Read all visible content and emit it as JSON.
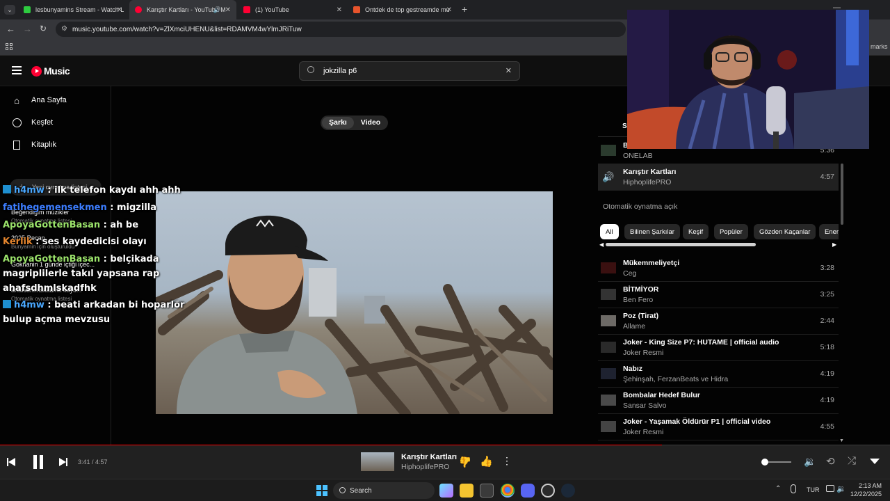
{
  "browser": {
    "tabs": [
      {
        "title": "lesbunyamins Stream - Watch L",
        "fav_color": "#2ecc40"
      },
      {
        "title": "Karıştır Kartları - YouTube M",
        "fav_color": "#ff0033"
      },
      {
        "title": "(1) YouTube",
        "fav_color": "#ff0033"
      },
      {
        "title": "Ontdek de top gestreamde mu",
        "fav_color": "#e8542c"
      }
    ],
    "url": "music.youtube.com/watch?v=ZlXmciUHENU&list=RDAMVM4wYlmJRiTuw",
    "bookmarks_label": "marks"
  },
  "header": {
    "logo_text": "Music",
    "search_value": "jokzilla p6"
  },
  "sidebar": {
    "items": [
      {
        "label": "Ana Sayfa",
        "icon": "home-icon"
      },
      {
        "label": "Keşfet",
        "icon": "explore-icon"
      },
      {
        "label": "Kitaplık",
        "icon": "library-icon"
      }
    ],
    "new_playlist": "Yeni oynatma listesi",
    "playlists": [
      {
        "title": "Beğendiğim müzikler",
        "sub": "Otomatik oynatma listesi"
      },
      {
        "title": "2025 Recap",
        "sub": "Bunyamin için oluşturuldu"
      },
      {
        "title": "Gokhanin 1 günde içtiği içec...",
        "sub": ""
      },
      {
        "title": "ahafsdhmlskadfhk kayd...",
        "sub": "Otomatik oynatma listesi"
      }
    ]
  },
  "chat": [
    {
      "user": "h4mw",
      "color": "#4aa8ff",
      "badge": true,
      "msg": " : ilk telefon kaydı ahh ahh"
    },
    {
      "user": "fatihegemensekmen",
      "color": "#3c7dff",
      "badge": false,
      "msg": " : migzilla"
    },
    {
      "user": "ApoyaGottenBasan",
      "color": "#9be36b",
      "badge": false,
      "msg": " : ah be"
    },
    {
      "user": "Kerlik",
      "color": "#e5862e",
      "badge": false,
      "msg": " : ses kaydedicisi olayı"
    },
    {
      "user": "ApoyaGottenBasan",
      "color": "#9be36b",
      "badge": false,
      "msg": " : belçikada"
    },
    {
      "user": "",
      "color": "#fff",
      "badge": false,
      "msg": "magriplilerle takıl yapsana rap"
    },
    {
      "user": "",
      "color": "#fff",
      "badge": false,
      "msg": "ahafsdhmlskadfhk"
    },
    {
      "user": "h4mw",
      "color": "#4aa8ff",
      "badge": true,
      "msg": " : beati arkadan bi hoparlör"
    },
    {
      "user": "",
      "color": "#fff",
      "badge": false,
      "msg": "bulup açma mevzusu"
    }
  ],
  "toggle": {
    "song": "Şarkı",
    "video": "Video"
  },
  "queue": {
    "tab_partial": "S",
    "prev_item": {
      "title": "B",
      "artist": "ONELAB",
      "duration": "5:36"
    },
    "current": {
      "title": "Karıştır Kartları",
      "artist": "HiphoplifePRO",
      "duration": "4:57"
    },
    "autoplay_label": "Otomatik oynatma açık",
    "chips": [
      "All",
      "Bilinen Şarkılar",
      "Keşif",
      "Popüler",
      "Gözden Kaçanlar",
      "Enerj"
    ],
    "items": [
      {
        "title": "Mükemmeliyetçi",
        "artist": "Ceg",
        "duration": "3:28"
      },
      {
        "title": "BİTMİYOR",
        "artist": "Ben Fero",
        "duration": "3:25"
      },
      {
        "title": "Poz (Tirat)",
        "artist": "Allame",
        "duration": "2:44"
      },
      {
        "title": "Joker - King Size P7: HUTAME | official audio",
        "artist": "Joker Resmi",
        "duration": "5:18"
      },
      {
        "title": "Nabız",
        "artist": "Şehinşah, FerzanBeats ve Hidra",
        "duration": "4:19"
      },
      {
        "title": "Bombalar Hedef Bulur",
        "artist": "Sansar Salvo",
        "duration": "4:19"
      },
      {
        "title": "Joker - Yaşamak Öldürür P1 | official video",
        "artist": "Joker Resmi",
        "duration": "4:55"
      }
    ]
  },
  "player": {
    "time": "3:41 / 4:57",
    "progress": 0.744,
    "title": "Karıştır Kartları",
    "artist": "HiphoplifePRO",
    "volume": 0.05
  },
  "taskbar": {
    "search_label": "Search",
    "lang": "TUR",
    "time": "2:13 AM",
    "date": "12/22/2025"
  }
}
